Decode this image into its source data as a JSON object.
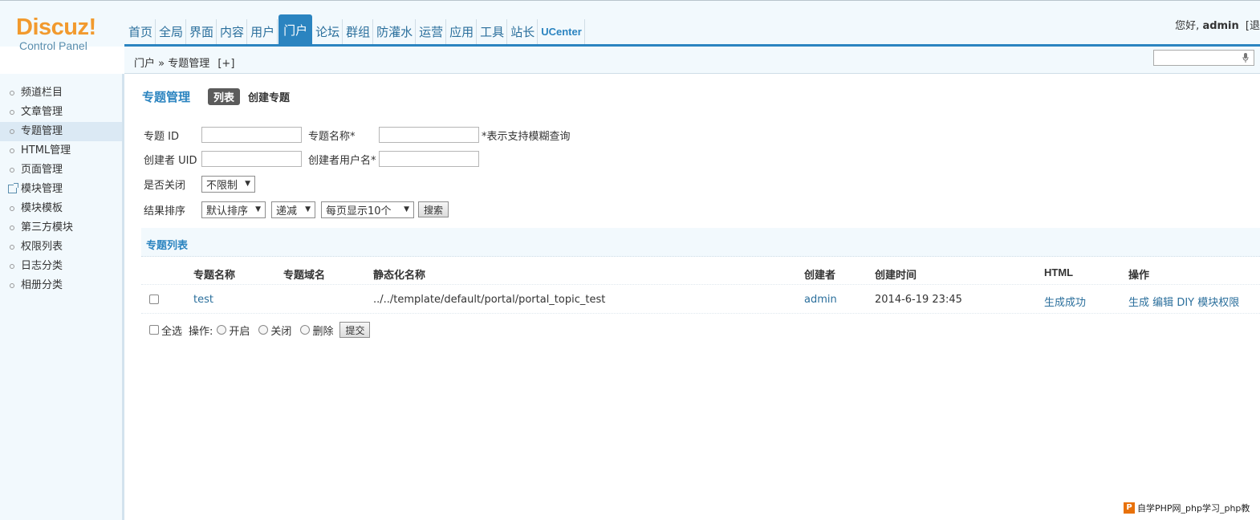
{
  "logo": {
    "main": "Discuz!",
    "sub": "Control Panel"
  },
  "topnav": [
    {
      "label": "首页",
      "active": false
    },
    {
      "label": "全局",
      "active": false
    },
    {
      "label": "界面",
      "active": false
    },
    {
      "label": "内容",
      "active": false
    },
    {
      "label": "用户",
      "active": false
    },
    {
      "label": "门户",
      "active": true
    },
    {
      "label": "论坛",
      "active": false
    },
    {
      "label": "群组",
      "active": false
    },
    {
      "label": "防灌水",
      "active": false
    },
    {
      "label": "运营",
      "active": false
    },
    {
      "label": "应用",
      "active": false
    },
    {
      "label": "工具",
      "active": false
    },
    {
      "label": "站长",
      "active": false
    },
    {
      "label": "UCenter",
      "active": false
    }
  ],
  "user": {
    "greeting": "您好,",
    "name": "admin",
    "logout": "[退"
  },
  "breadcrumb": {
    "path": "门户 » 专题管理",
    "add": "[+]"
  },
  "sidebar": {
    "items": [
      {
        "label": "频道栏目",
        "active": false
      },
      {
        "label": "文章管理",
        "active": false
      },
      {
        "label": "专题管理",
        "active": true
      },
      {
        "label": "HTML管理",
        "active": false
      },
      {
        "label": "页面管理",
        "active": false
      },
      {
        "label": "模块管理",
        "active": false,
        "icon": "external-link-icon"
      },
      {
        "label": "模块模板",
        "active": false
      },
      {
        "label": "第三方模块",
        "active": false
      },
      {
        "label": "权限列表",
        "active": false
      },
      {
        "label": "日志分类",
        "active": false
      },
      {
        "label": "相册分类",
        "active": false
      }
    ]
  },
  "page": {
    "title": "专题管理",
    "tab_list": "列表",
    "tab_create": "创建专题"
  },
  "filters": {
    "topic_id_label": "专题 ID",
    "topic_name_label": "专题名称*",
    "fuzzy_note": "*表示支持模糊查询",
    "creator_uid_label": "创建者 UID",
    "creator_name_label": "创建者用户名*",
    "closed_label": "是否关闭",
    "closed_value": "不限制",
    "sort_label": "结果排序",
    "sort_value": "默认排序",
    "order_value": "递减",
    "perpage_value": "每页显示10个",
    "search_button": "搜索"
  },
  "list": {
    "section_title": "专题列表",
    "columns": [
      "专题名称",
      "专题域名",
      "静态化名称",
      "创建者",
      "创建时间",
      "HTML",
      "操作"
    ],
    "rows": [
      {
        "name": "test",
        "domain": "",
        "static_name": "../../template/default/portal/portal_topic_test",
        "creator": "admin",
        "created": "2014-6-19 23:45",
        "html": "生成成功",
        "actions": [
          "生成",
          "编辑",
          "DIY",
          "模块权限"
        ]
      }
    ]
  },
  "bulk": {
    "select_all": "全选",
    "op_label": "操作:",
    "open": "开启",
    "close": "关闭",
    "delete": "删除",
    "submit": "提交"
  },
  "watermark": {
    "icon": "P",
    "text": "自学PHP网_php学习_php教"
  },
  "colors": {
    "accent": "#2b84c0",
    "logo_orange": "#f29a2e",
    "panel_bg": "#f2f9fd"
  }
}
